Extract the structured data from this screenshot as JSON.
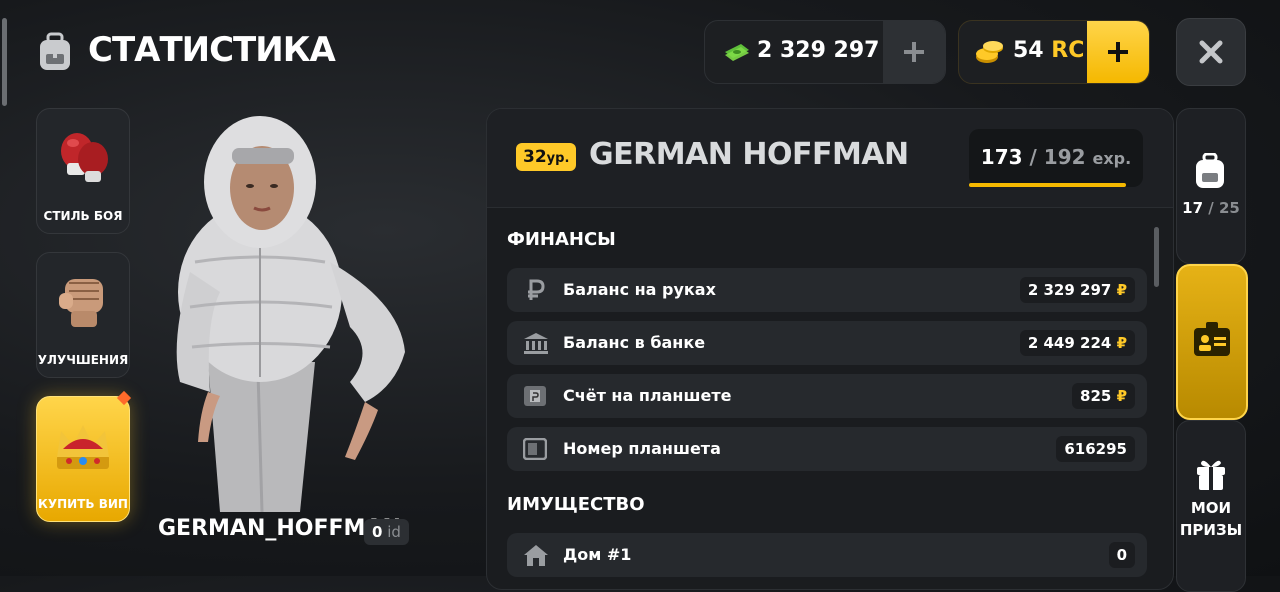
{
  "header": {
    "title": "СТАТИСТИКА",
    "money": "2 329 297",
    "money_currency": "₽",
    "rc_amount": "54",
    "rc_currency": "RC"
  },
  "side_buttons": [
    {
      "label": "СТИЛЬ БОЯ",
      "icon": "boxing-gloves-icon"
    },
    {
      "label": "УЛУЧШЕНИЯ",
      "icon": "fist-icon"
    },
    {
      "label": "КУПИТЬ ВИП",
      "icon": "crown-icon"
    }
  ],
  "character": {
    "name": "GERMAN_HOFFMAN",
    "id_value": "0",
    "id_label": "id"
  },
  "profile": {
    "level": "32",
    "level_suffix": "ур.",
    "name": "GERMAN HOFFMAN",
    "exp_current": "173",
    "exp_max": "192",
    "exp_unit": "exp.",
    "exp_fraction": 0.901
  },
  "finances": {
    "title": "ФИНАНСЫ",
    "rows": [
      {
        "label": "Баланс на руках",
        "value": "2 329 297",
        "currency": "₽",
        "icon": "ruble-icon"
      },
      {
        "label": "Баланс в банке",
        "value": "2 449 224",
        "currency": "₽",
        "icon": "bank-icon"
      },
      {
        "label": "Счёт на планшете",
        "value": "825",
        "currency": "₽",
        "icon": "tablet-account-icon"
      },
      {
        "label": "Номер планшета",
        "value": "616295",
        "currency": "",
        "icon": "tablet-icon"
      }
    ]
  },
  "property": {
    "title": "ИМУЩЕСТВО",
    "rows": [
      {
        "label": "Дом #1",
        "value": "0",
        "icon": "house-icon"
      }
    ]
  },
  "right_tabs": {
    "inventory_current": "17",
    "inventory_max": "25",
    "prizes_line1": "МОИ",
    "prizes_line2": "ПРИЗЫ"
  },
  "colors": {
    "accent": "#ffc928",
    "panel": "#1a1c1f",
    "row": "#26292d"
  }
}
